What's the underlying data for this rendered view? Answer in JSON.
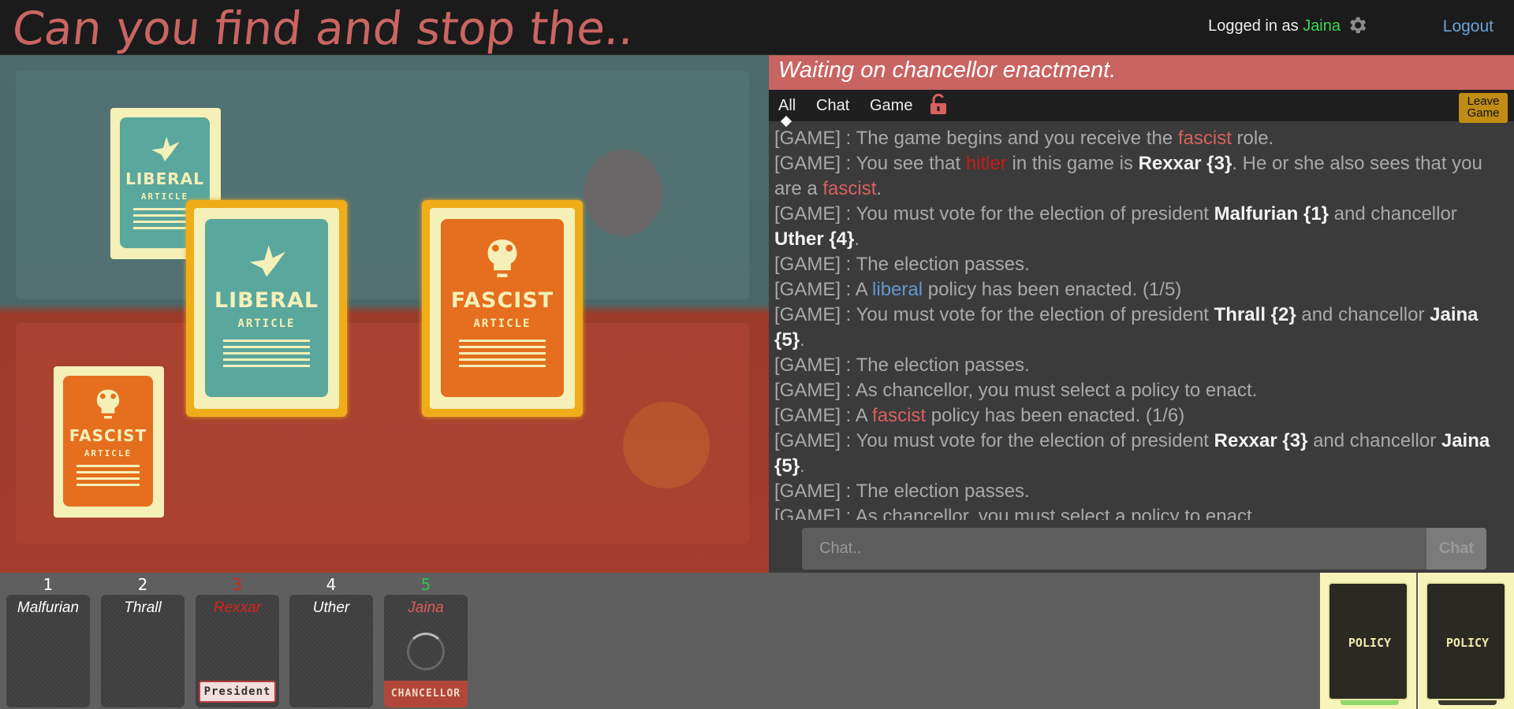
{
  "header": {
    "title": "Can you find and stop the..",
    "logged_in_prefix": "Logged in as",
    "username": "Jaina",
    "logout_label": "Logout"
  },
  "board": {
    "cards": [
      {
        "type": "liberal",
        "word": "LIBERAL",
        "sub": "ARTICLE",
        "selected": false
      },
      {
        "type": "liberal",
        "word": "LIBERAL",
        "sub": "ARTICLE",
        "selected": true
      },
      {
        "type": "fascist",
        "word": "FASCIST",
        "sub": "ARTICLE",
        "selected": true
      },
      {
        "type": "fascist",
        "word": "FASCIST",
        "sub": "ARTICLE",
        "selected": false
      }
    ]
  },
  "panel": {
    "status": "Waiting on chancellor enactment.",
    "tabs": [
      "All",
      "Chat",
      "Game"
    ],
    "active_tab": "All",
    "leave_label_1": "Leave",
    "leave_label_2": "Game",
    "chat_placeholder": "Chat..",
    "chat_button": "Chat"
  },
  "log": [
    [
      {
        "t": "[GAME] : The game begins and you receive the "
      },
      {
        "t": "fascist",
        "c": "f"
      },
      {
        "t": " role."
      }
    ],
    [
      {
        "t": "[GAME] : You see that "
      },
      {
        "t": "hitler",
        "c": "h"
      },
      {
        "t": " in this game is "
      },
      {
        "t": "Rexxar {3}",
        "c": "b"
      },
      {
        "t": ". He or she also sees that you are a "
      },
      {
        "t": "fascist",
        "c": "f"
      },
      {
        "t": "."
      }
    ],
    [
      {
        "t": "[GAME] : You must vote for the election of president "
      },
      {
        "t": "Malfurian {1}",
        "c": "b"
      },
      {
        "t": " and chancellor "
      },
      {
        "t": "Uther {4}",
        "c": "b"
      },
      {
        "t": "."
      }
    ],
    [
      {
        "t": "[GAME] : The election passes."
      }
    ],
    [
      {
        "t": "[GAME] : A "
      },
      {
        "t": "liberal",
        "c": "l"
      },
      {
        "t": " policy has been enacted. (1/5)"
      }
    ],
    [
      {
        "t": "[GAME] : You must vote for the election of president "
      },
      {
        "t": "Thrall {2}",
        "c": "b"
      },
      {
        "t": " and chancellor "
      },
      {
        "t": "Jaina {5}",
        "c": "b"
      },
      {
        "t": "."
      }
    ],
    [
      {
        "t": "[GAME] : The election passes."
      }
    ],
    [
      {
        "t": "[GAME] : As chancellor, you must select a policy to enact."
      }
    ],
    [
      {
        "t": "[GAME] : A "
      },
      {
        "t": "fascist",
        "c": "f"
      },
      {
        "t": " policy has been enacted. (1/6)"
      }
    ],
    [
      {
        "t": "[GAME] : You must vote for the election of president "
      },
      {
        "t": "Rexxar {3}",
        "c": "b"
      },
      {
        "t": " and chancellor "
      },
      {
        "t": "Jaina {5}",
        "c": "b"
      },
      {
        "t": "."
      }
    ],
    [
      {
        "t": "[GAME] : The election passes."
      }
    ],
    [
      {
        "t": "[GAME] : As chancellor, you must select a policy to enact."
      }
    ]
  ],
  "players": [
    {
      "num": "1",
      "name": "Malfurian"
    },
    {
      "num": "2",
      "name": "Thrall"
    },
    {
      "num": "3",
      "name": "Rexxar",
      "role_tag": "President"
    },
    {
      "num": "4",
      "name": "Uther"
    },
    {
      "num": "5",
      "name": "Jaina",
      "role_tag": "CHANCELLOR"
    }
  ],
  "decks": [
    {
      "label": "POLICY",
      "tag_color": "#8fd86a"
    },
    {
      "label": "POLICY",
      "tag_color": "#3a3a30"
    }
  ],
  "colors": {
    "accent": "#c86462",
    "liberal": "#5aa79d",
    "fascist": "#e56e1f",
    "highlight": "#f0ad1a",
    "user": "#3dd655",
    "link": "#6aa3d5"
  }
}
